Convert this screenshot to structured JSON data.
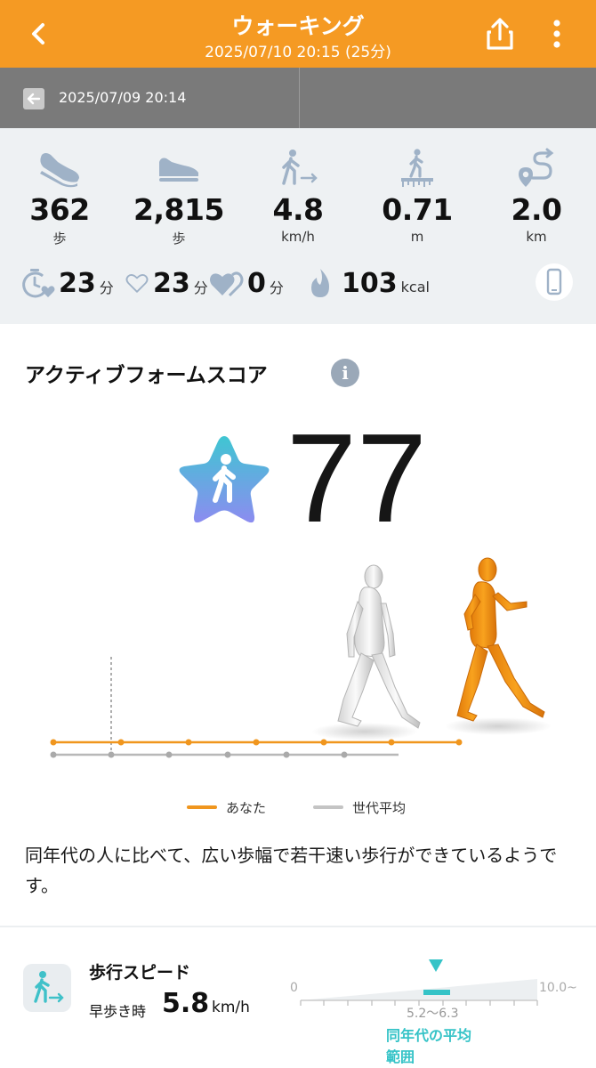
{
  "header": {
    "title": "ウォーキング",
    "subtitle": "2025/07/10 20:15 (25分)"
  },
  "nav": {
    "prev_date": "2025/07/09 20:14"
  },
  "stats": [
    {
      "icon": "sneaker-icon",
      "value": "362",
      "unit": "歩"
    },
    {
      "icon": "shoe-icon",
      "value": "2,815",
      "unit": "歩"
    },
    {
      "icon": "walking-speed-icon",
      "value": "4.8",
      "unit": "km/h"
    },
    {
      "icon": "elevation-icon",
      "value": "0.71",
      "unit": "m"
    },
    {
      "icon": "route-distance-icon",
      "value": "2.0",
      "unit": "km"
    }
  ],
  "secondary_stats": [
    {
      "icon": "timer-heart-icon",
      "value": "23",
      "unit": "分"
    },
    {
      "icon": "heart-outline-icon",
      "value": "23",
      "unit": "分"
    },
    {
      "icon": "double-heart-icon",
      "value": "0",
      "unit": "分"
    },
    {
      "icon": "flame-icon",
      "value": "103",
      "unit": "kcal"
    }
  ],
  "score_section": {
    "title": "アクティブフォームスコア",
    "info": "i",
    "score": "77"
  },
  "legend": {
    "you": "あなた",
    "average": "世代平均"
  },
  "description": "同年代の人に比べて、広い歩幅で若干速い歩行ができているようです。",
  "speed": {
    "title": "歩行スピード",
    "label": "早歩き時",
    "value": "5.8",
    "unit": "km/h",
    "gauge_min": "0",
    "gauge_max": "10.0~",
    "avg_range": "5.2〜6.3",
    "avg_label": "同年代の平均範囲"
  },
  "colors": {
    "header": "#f59a23",
    "you_line": "#f0961e",
    "average_line": "#b8b8b8",
    "teal": "#35c3c7"
  }
}
